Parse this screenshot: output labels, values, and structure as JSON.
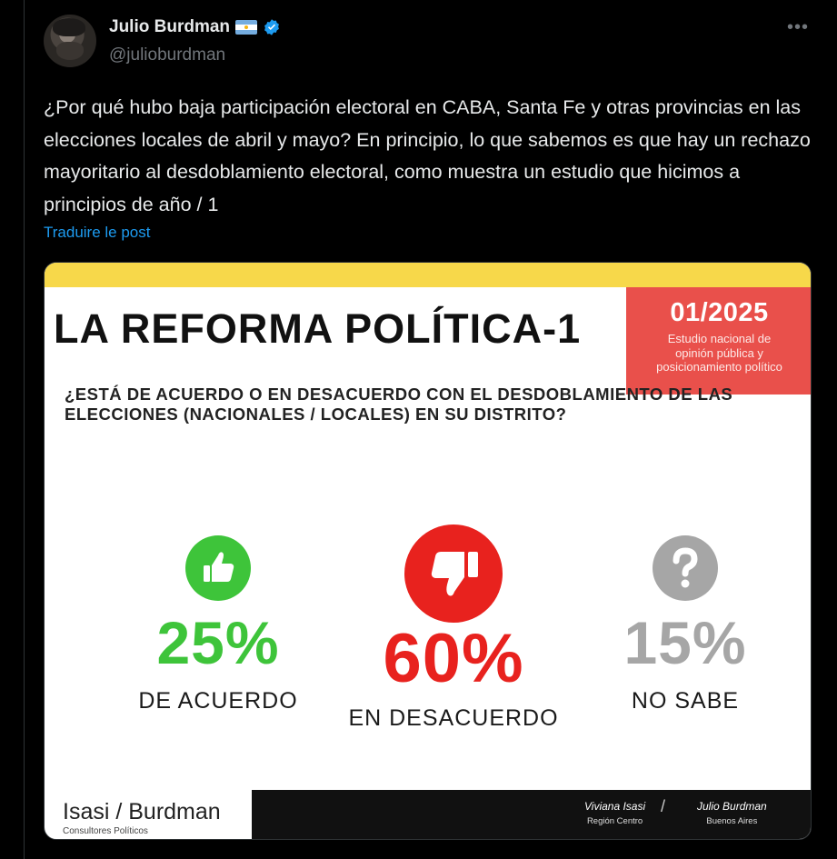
{
  "tweet": {
    "author_name": "Julio Burdman",
    "author_handle": "@julioburdman",
    "more_label": "•••",
    "text": "¿Por qué hubo baja participación electoral en CABA, Santa Fe y otras provincias en las elecciones locales de abril y mayo? En principio, lo que sabemos es que hay un rechazo mayoritario al desdoblamiento electoral, como muestra un estudio que hicimos a principios de año / 1",
    "translate_label": "Traduire le post"
  },
  "card": {
    "title": "LA REFORMA POLÍTICA-1",
    "badge_code": "01/2025",
    "badge_desc_1": "Estudio nacional de",
    "badge_desc_2": "opinión pública y",
    "badge_desc_3": "posicionamiento político",
    "question": "¿ESTÁ DE ACUERDO O EN DESACUERDO CON EL DESDOBLAMIENTO DE LAS ELECCIONES  (NACIONALES / LOCALES) EN SU DISTRITO?",
    "stats": [
      {
        "pct": "25%",
        "label": "DE ACUERDO",
        "icon": "thumbs-up-icon",
        "color": "#3ec43a"
      },
      {
        "pct": "60%",
        "label": "EN DESACUERDO",
        "icon": "thumbs-down-icon",
        "color": "#e8221e"
      },
      {
        "pct": "15%",
        "label": "NO SABE",
        "icon": "question-icon",
        "color": "#a6a6a6"
      }
    ],
    "brand": "Isasi / Burdman",
    "brand_sub": "Consultores Políticos",
    "person1_name": "Viviana Isasi",
    "person1_region": "Región Centro",
    "separator": "/",
    "person2_name": "Julio Burdman",
    "person2_region": "Buenos Aires"
  },
  "colors": {
    "background": "#000000",
    "link": "#1d9bf0",
    "topbar": "#f7d84a",
    "badge": "#e9504b"
  }
}
